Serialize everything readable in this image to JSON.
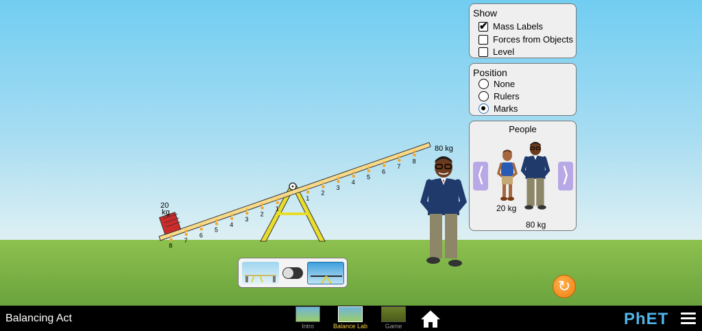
{
  "app": {
    "title": "Balancing Act"
  },
  "show_panel": {
    "title": "Show",
    "options": [
      {
        "label": "Mass Labels",
        "checked": true
      },
      {
        "label": "Forces from Objects",
        "checked": false
      },
      {
        "label": "Level",
        "checked": false
      }
    ]
  },
  "position_panel": {
    "title": "Position",
    "options": [
      {
        "label": "None",
        "selected": false
      },
      {
        "label": "Rulers",
        "selected": false
      },
      {
        "label": "Marks",
        "selected": true
      }
    ]
  },
  "people_panel": {
    "title": "People",
    "people": [
      {
        "mass": "20 kg"
      },
      {
        "mass": "80 kg"
      }
    ]
  },
  "scene": {
    "brick_mass_top": "20",
    "brick_mass_bottom": "kg",
    "person_mass": "80 kg",
    "left_marks": [
      "8",
      "7",
      "6",
      "5",
      "4",
      "3",
      "2",
      "1"
    ],
    "right_marks": [
      "1",
      "2",
      "3",
      "4",
      "5",
      "6",
      "7",
      "8"
    ]
  },
  "navbar": {
    "screens": [
      {
        "label": "Intro",
        "active": false
      },
      {
        "label": "Balance Lab",
        "active": true
      },
      {
        "label": "Game",
        "active": false
      }
    ],
    "logo": "PhET"
  },
  "colors": {
    "sky": "#71cdf1",
    "ground": "#8dc14f",
    "plank": "#f6d98a",
    "mark": "#f6a623",
    "brick": "#cc2b2b",
    "reset": "#ef7d12"
  }
}
